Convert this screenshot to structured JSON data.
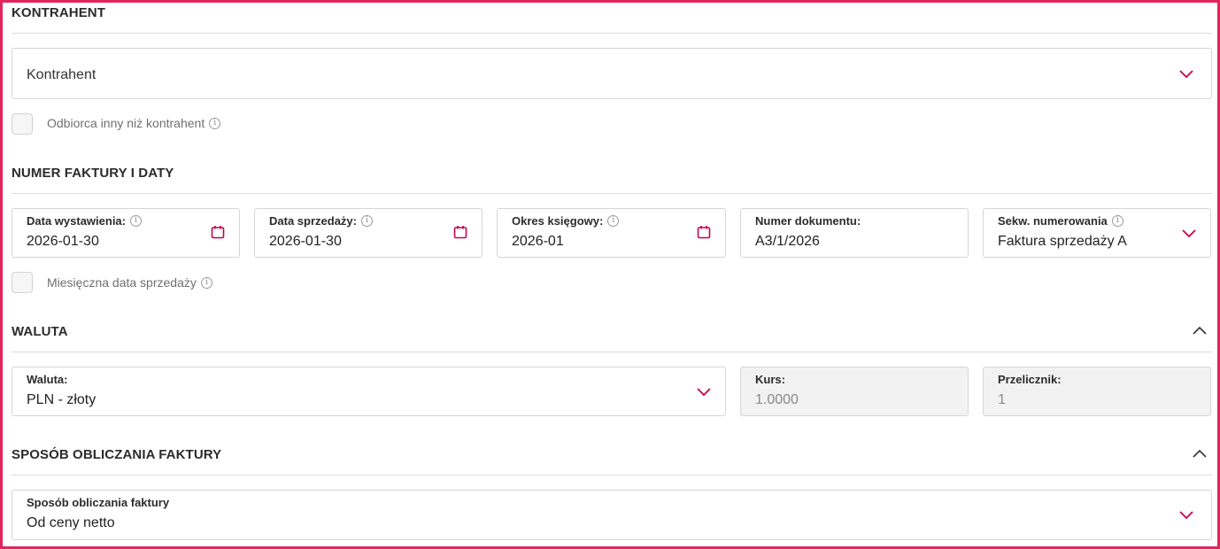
{
  "colors": {
    "accent": "#c8004f",
    "frame": "#e0245e"
  },
  "contractor": {
    "section_title": "KONTRAHENT",
    "select_placeholder": "Kontrahent",
    "checkbox_label": "Odbiorca inny niż kontrahent"
  },
  "invoice": {
    "section_title": "NUMER FAKTURY I DATY",
    "issue_date_label": "Data wystawienia:",
    "issue_date_value": "2026-01-30",
    "sale_date_label": "Data sprzedaży:",
    "sale_date_value": "2026-01-30",
    "period_label": "Okres księgowy:",
    "period_value": "2026-01",
    "doc_number_label": "Numer dokumentu:",
    "doc_number_value": "A3/1/2026",
    "sequence_label": "Sekw. numerowania",
    "sequence_value": "Faktura sprzedaży A",
    "monthly_checkbox_label": "Miesięczna data sprzedaży"
  },
  "currency": {
    "section_title": "WALUTA",
    "currency_label": "Waluta:",
    "currency_value": "PLN - złoty",
    "rate_label": "Kurs:",
    "rate_value": "1.0000",
    "converter_label": "Przelicznik:",
    "converter_value": "1"
  },
  "calculation": {
    "section_title": "SPOSÓB OBLICZANIA FAKTURY",
    "method_label": "Sposób obliczania faktury",
    "method_value": "Od ceny netto"
  },
  "icons": {
    "chevron_down": "chevron-down-icon",
    "chevron_up": "chevron-up-icon",
    "calendar": "calendar-icon",
    "info": "info-icon"
  }
}
